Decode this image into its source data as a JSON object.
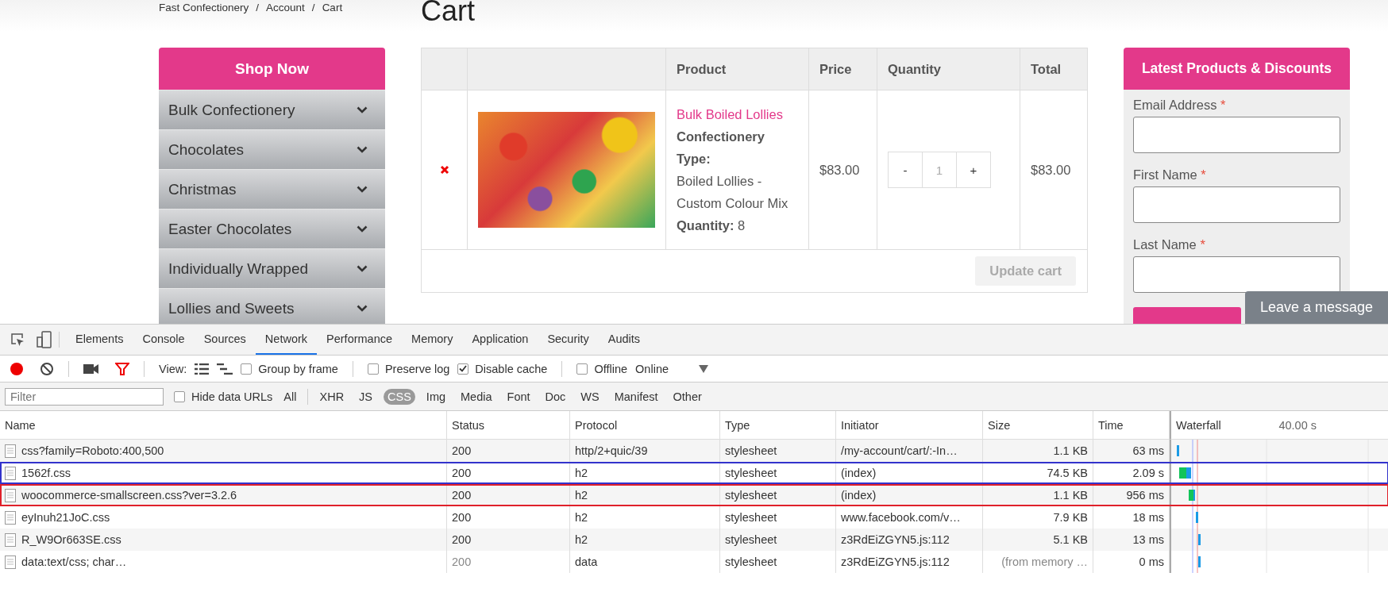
{
  "breadcrumb": {
    "items": [
      "Fast Confectionery",
      "Account",
      "Cart"
    ],
    "separator": "/"
  },
  "page_title": "Cart",
  "sidebar": {
    "title": "Shop Now",
    "items": [
      {
        "label": "Bulk Confectionery"
      },
      {
        "label": "Chocolates"
      },
      {
        "label": "Christmas"
      },
      {
        "label": "Easter Chocolates"
      },
      {
        "label": "Individually Wrapped"
      },
      {
        "label": "Lollies and Sweets"
      }
    ]
  },
  "cart": {
    "columns": [
      "Product",
      "Price",
      "Quantity",
      "Total"
    ],
    "rows": [
      {
        "product_name": "Bulk Boiled Lollies",
        "meta": [
          {
            "label": "Confectionery Type:",
            "value": "Boiled Lollies - Custom Colour Mix"
          },
          {
            "label": "Quantity:",
            "value": "8"
          }
        ],
        "price": "$83.00",
        "quantity": {
          "minus": "-",
          "value": "1",
          "plus": "+"
        },
        "total": "$83.00"
      }
    ],
    "update_button": {
      "label": "Update cart",
      "disabled": true
    }
  },
  "newsletter": {
    "title": "Latest Products & Discounts",
    "required_mark": "*",
    "fields": [
      {
        "label": "Email Address",
        "required": true
      },
      {
        "label": "First Name",
        "required": true
      },
      {
        "label": "Last Name",
        "required": true
      }
    ]
  },
  "chat_tab": "Leave a message",
  "devtools": {
    "tabs": [
      {
        "label": "Elements",
        "selected": false
      },
      {
        "label": "Console",
        "selected": false
      },
      {
        "label": "Sources",
        "selected": false
      },
      {
        "label": "Network",
        "selected": true
      },
      {
        "label": "Performance",
        "selected": false
      },
      {
        "label": "Memory",
        "selected": false
      },
      {
        "label": "Application",
        "selected": false
      },
      {
        "label": "Security",
        "selected": false
      },
      {
        "label": "Audits",
        "selected": false
      }
    ],
    "view_label": "View:",
    "options": [
      {
        "label": "Group by frame",
        "checked": false
      },
      {
        "label": "Preserve log",
        "checked": false
      },
      {
        "label": "Disable cache",
        "checked": true
      },
      {
        "label": "Offline",
        "checked": false
      }
    ],
    "throttling": "Online",
    "filter": {
      "placeholder": "Filter"
    },
    "hide_data_urls": {
      "label": "Hide data URLs",
      "checked": false
    },
    "types": [
      {
        "label": "All",
        "selected": false
      },
      {
        "label": "XHR",
        "selected": false
      },
      {
        "label": "JS",
        "selected": false
      },
      {
        "label": "CSS",
        "selected": true
      },
      {
        "label": "Img",
        "selected": false
      },
      {
        "label": "Media",
        "selected": false
      },
      {
        "label": "Font",
        "selected": false
      },
      {
        "label": "Doc",
        "selected": false
      },
      {
        "label": "WS",
        "selected": false
      },
      {
        "label": "Manifest",
        "selected": false
      },
      {
        "label": "Other",
        "selected": false
      }
    ]
  },
  "network": {
    "columns": [
      "Name",
      "Status",
      "Protocol",
      "Type",
      "Initiator",
      "Size",
      "Time",
      "Waterfall"
    ],
    "waterfall_tick": "40.00 s",
    "rows": [
      {
        "name": "css?family=Roboto:400,500",
        "status": "200",
        "protocol": "http/2+quic/39",
        "type": "stylesheet",
        "initiator": "/my-account/cart/:-In…",
        "size": "1.1 KB",
        "time": "63 ms",
        "from_cache": false
      },
      {
        "name": "1562f.css",
        "status": "200",
        "protocol": "h2",
        "type": "stylesheet",
        "initiator": "(index)",
        "size": "74.5 KB",
        "time": "2.09 s",
        "from_cache": false,
        "color": "#3333cc"
      },
      {
        "name": "woocommerce-smallscreen.css?ver=3.2.6",
        "status": "200",
        "protocol": "h2",
        "type": "stylesheet",
        "initiator": "(index)",
        "size": "1.1 KB",
        "time": "956 ms",
        "from_cache": false,
        "color": "#e0202a"
      },
      {
        "name": "eyInuh21JoC.css",
        "status": "200",
        "protocol": "h2",
        "type": "stylesheet",
        "initiator": "www.facebook.com/v…",
        "size": "7.9 KB",
        "time": "18 ms",
        "from_cache": false
      },
      {
        "name": "R_W9Or663SE.css",
        "status": "200",
        "protocol": "h2",
        "type": "stylesheet",
        "initiator": "z3RdEiZGYN5.js:112",
        "size": "5.1 KB",
        "time": "13 ms",
        "from_cache": false
      },
      {
        "name": "data:text/css; char…",
        "status": "200",
        "protocol": "data",
        "type": "stylesheet",
        "initiator": "z3RdEiZGYN5.js:112",
        "size": "(from memory …",
        "time": "0 ms",
        "from_cache": true
      }
    ]
  }
}
